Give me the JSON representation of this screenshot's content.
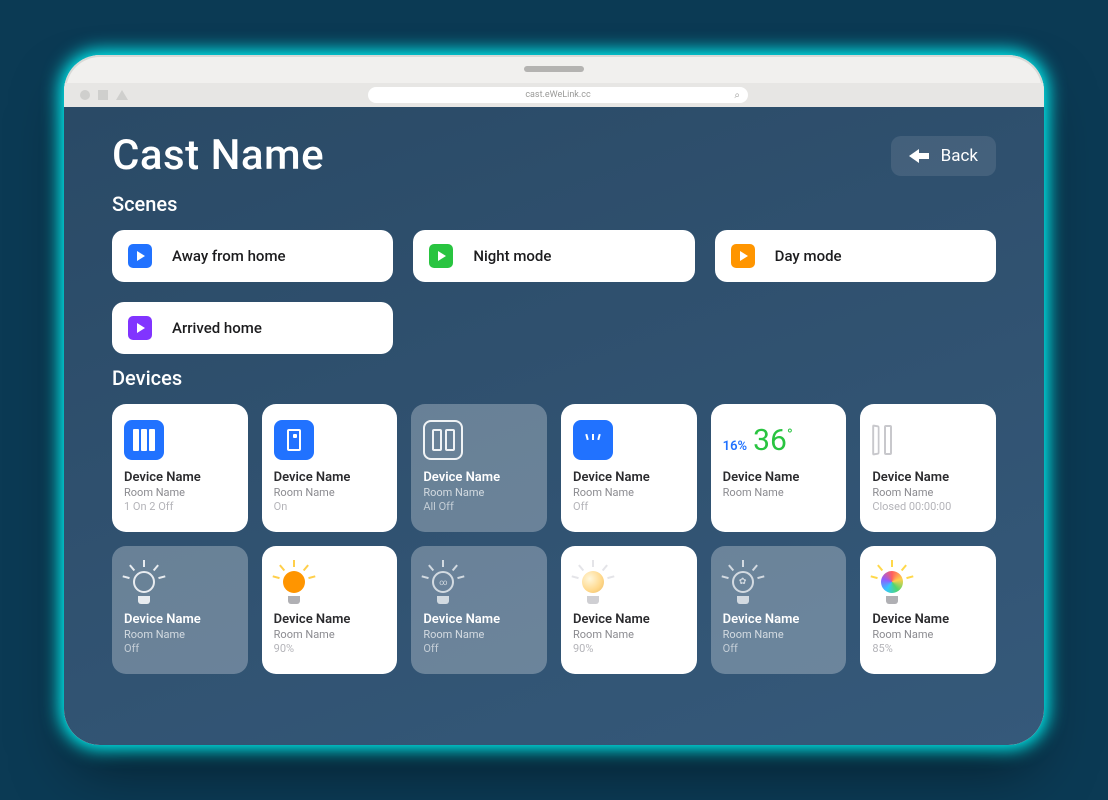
{
  "browser": {
    "url": "cast.eWeLink.cc"
  },
  "header": {
    "title": "Cast Name",
    "back_label": "Back"
  },
  "sections": {
    "scenes_label": "Scenes",
    "devices_label": "Devices"
  },
  "scenes": [
    {
      "label": "Away from home",
      "color": "blue"
    },
    {
      "label": "Night mode",
      "color": "green"
    },
    {
      "label": "Day mode",
      "color": "orange"
    },
    {
      "label": "Arrived home",
      "color": "purple"
    }
  ],
  "devices": [
    {
      "name": "Device Name",
      "room": "Room Name",
      "status": "1 On 2 Off"
    },
    {
      "name": "Device Name",
      "room": "Room Name",
      "status": "On"
    },
    {
      "name": "Device Name",
      "room": "Room Name",
      "status": "All Off"
    },
    {
      "name": "Device Name",
      "room": "Room Name",
      "status": "Off"
    },
    {
      "name": "Device Name",
      "room": "Room Name",
      "humidity": "16%",
      "temperature": "36",
      "status": ""
    },
    {
      "name": "Device Name",
      "room": "Room Name",
      "status": "Closed 00:00:00"
    },
    {
      "name": "Device Name",
      "room": "Room Name",
      "status": "Off"
    },
    {
      "name": "Device Name",
      "room": "Room Name",
      "status": "90%"
    },
    {
      "name": "Device Name",
      "room": "Room Name",
      "status": "Off"
    },
    {
      "name": "Device Name",
      "room": "Room Name",
      "status": "90%"
    },
    {
      "name": "Device Name",
      "room": "Room Name",
      "status": "Off"
    },
    {
      "name": "Device Name",
      "room": "Room Name",
      "status": "85%"
    }
  ],
  "colors": {
    "accent_blue": "#2172ff",
    "accent_green": "#29c440",
    "accent_orange": "#ff9500",
    "accent_purple": "#8134ff"
  }
}
